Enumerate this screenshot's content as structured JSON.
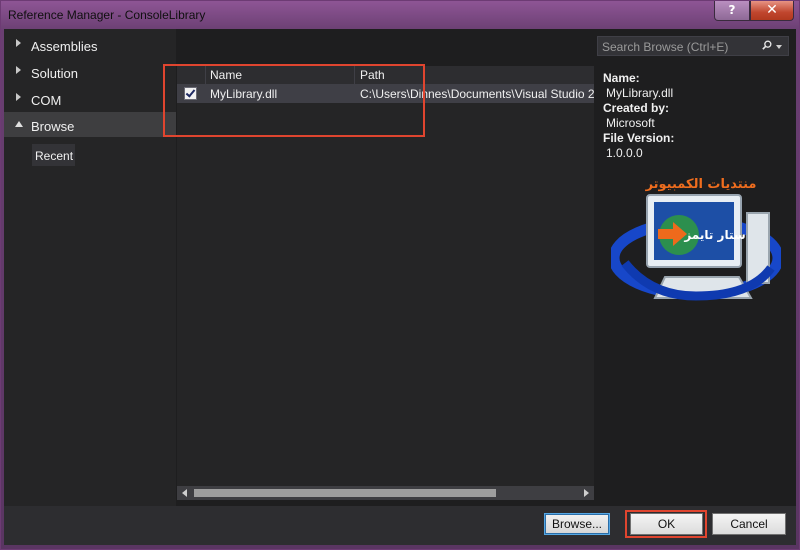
{
  "window": {
    "title": "Reference Manager - ConsoleLibrary",
    "help_label": "?",
    "close_label": "✕"
  },
  "nav": {
    "items": [
      {
        "label": "Assemblies",
        "state": "collapsed"
      },
      {
        "label": "Solution",
        "state": "collapsed"
      },
      {
        "label": "COM",
        "state": "collapsed"
      },
      {
        "label": "Browse",
        "state": "expanded-selected"
      }
    ],
    "sub_items": [
      {
        "label": "Recent"
      }
    ]
  },
  "list": {
    "columns": [
      "Name",
      "Path"
    ],
    "rows": [
      {
        "checked": true,
        "name": "MyLibrary.dll",
        "path": "C:\\Users\\Dinnes\\Documents\\Visual Studio 20"
      }
    ]
  },
  "search": {
    "placeholder": "Search Browse (Ctrl+E)",
    "icon": "search-icon"
  },
  "details": {
    "name_label": "Name:",
    "name_value": "MyLibrary.dll",
    "created_label": "Created by:",
    "created_value": "Microsoft",
    "version_label": "File Version:",
    "version_value": "1.0.0.0"
  },
  "logo": {
    "text_top": "منتديات الكمبيوتر",
    "text_screen": "ستار تايمز"
  },
  "buttons": {
    "browse": "Browse...",
    "ok": "OK",
    "cancel": "Cancel"
  },
  "colors": {
    "frame": "#7a4782",
    "highlight_box": "#e0452f",
    "selected_row": "#3f3f46"
  }
}
